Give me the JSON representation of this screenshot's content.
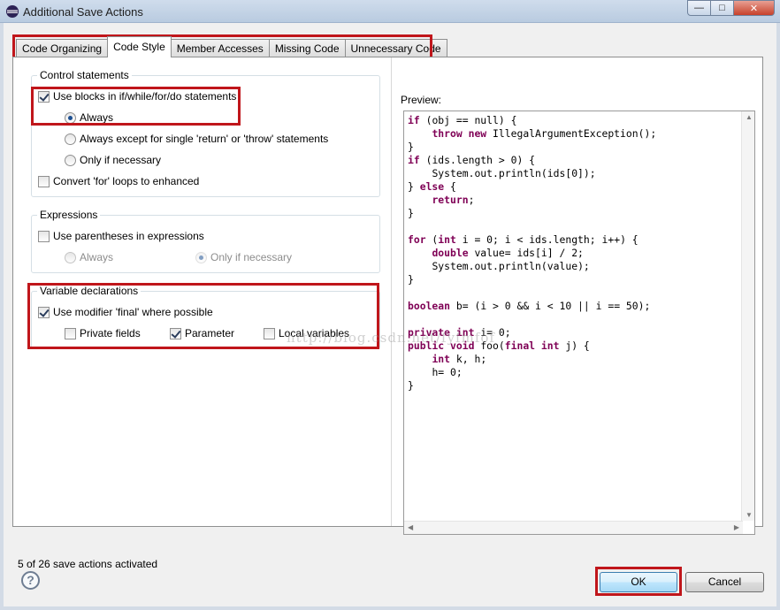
{
  "window": {
    "title": "Additional Save Actions",
    "app_icon": "eclipse-icon",
    "min_symbol": "—",
    "max_symbol": "□",
    "close_symbol": "✕"
  },
  "tabs": [
    {
      "label": "Code Organizing"
    },
    {
      "label": "Code Style"
    },
    {
      "label": "Member Accesses"
    },
    {
      "label": "Missing Code"
    },
    {
      "label": "Unnecessary Code"
    }
  ],
  "control_statements": {
    "title": "Control statements",
    "use_blocks": {
      "label": "Use blocks in if/while/for/do statements",
      "checked": true
    },
    "always": {
      "label": "Always",
      "selected": true
    },
    "always_except": {
      "label": "Always except for single 'return' or 'throw' statements",
      "selected": false
    },
    "only_if_necessary": {
      "label": "Only if necessary",
      "selected": false
    },
    "convert_for": {
      "label": "Convert 'for' loops to enhanced",
      "checked": false
    }
  },
  "expressions": {
    "title": "Expressions",
    "use_parentheses": {
      "label": "Use parentheses in expressions",
      "checked": false
    },
    "always": {
      "label": "Always",
      "selected": false
    },
    "only_if_necessary": {
      "label": "Only if necessary",
      "selected": true
    }
  },
  "variable_declarations": {
    "title": "Variable declarations",
    "use_final": {
      "label": "Use modifier 'final' where possible",
      "checked": true
    },
    "private_fields": {
      "label": "Private fields",
      "checked": false
    },
    "parameter": {
      "label": "Parameter",
      "checked": true
    },
    "local_variables": {
      "label": "Local variables",
      "checked": false
    }
  },
  "preview": {
    "label": "Preview:",
    "code": [
      "if (obj == null) {",
      "    throw new IllegalArgumentException();",
      "}",
      "if (ids.length > 0) {",
      "    System.out.println(ids[0]);",
      "} else {",
      "    return;",
      "}",
      "",
      "for (int i = 0; i < ids.length; i++) {",
      "    double value= ids[i] / 2;",
      "    System.out.println(value);",
      "}",
      "",
      "boolean b= (i > 0 && i < 10 || i == 50);",
      "",
      "private int i= 0;",
      "public void foo(final int j) {",
      "    int k, h;",
      "    h= 0;",
      "}"
    ],
    "keywords": [
      "if",
      "throw",
      "new",
      "else",
      "return",
      "for",
      "int",
      "double",
      "boolean",
      "private",
      "public",
      "void",
      "final"
    ]
  },
  "watermark": "http://blog.csdn.net/fyfmfof",
  "status": "5 of 26 save actions activated",
  "buttons": {
    "help": "?",
    "ok": "OK",
    "cancel": "Cancel"
  }
}
